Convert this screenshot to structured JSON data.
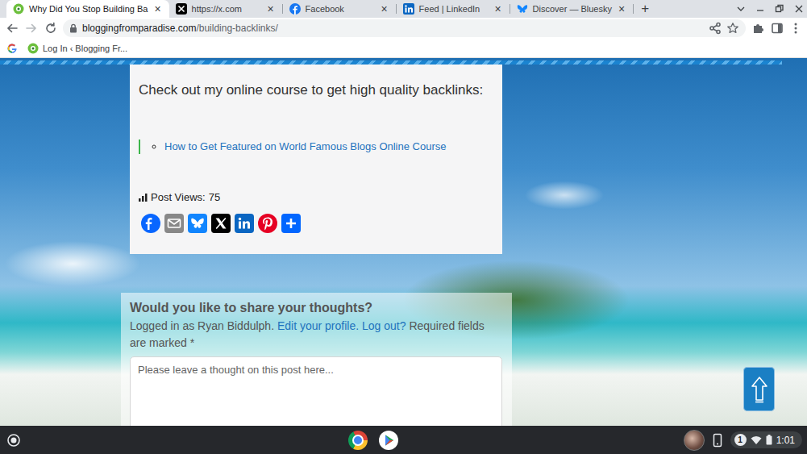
{
  "browser": {
    "tabs": [
      {
        "label": "Why Did You Stop Building Ba",
        "selected": true,
        "kind": "blog",
        "close": "×"
      },
      {
        "label": "https://x.com",
        "selected": false,
        "kind": "x",
        "close": "×"
      },
      {
        "label": "Facebook",
        "selected": false,
        "kind": "facebook",
        "close": "×"
      },
      {
        "label": "Feed | LinkedIn",
        "selected": false,
        "kind": "linkedin",
        "close": "×"
      },
      {
        "label": "Discover — Bluesky",
        "selected": false,
        "kind": "bluesky",
        "close": "×"
      }
    ],
    "new_tab": "+",
    "url": {
      "domain": "bloggingfromparadise.com",
      "path": "/building-backlinks/"
    },
    "bookmarks": [
      {
        "label": "Log In ‹ Blogging Fr..."
      }
    ]
  },
  "article": {
    "intro": "Check out my online course to get high quality backlinks:",
    "links": [
      "How to Get Featured on World Famous Blogs Online Course"
    ],
    "post_views_label": "Post Views:",
    "post_views": "75"
  },
  "comments": {
    "heading": "Would you like to share your thoughts?",
    "logged_in": "Logged in as Ryan Biddulph.",
    "edit_profile": "Edit your profile.",
    "log_out": "Log out?",
    "required_note": "Required fields are marked",
    "required_mark": "*",
    "placeholder": "Please leave a thought on this post here..."
  },
  "taskbar": {
    "notification_count": "1",
    "time": "1:01"
  }
}
